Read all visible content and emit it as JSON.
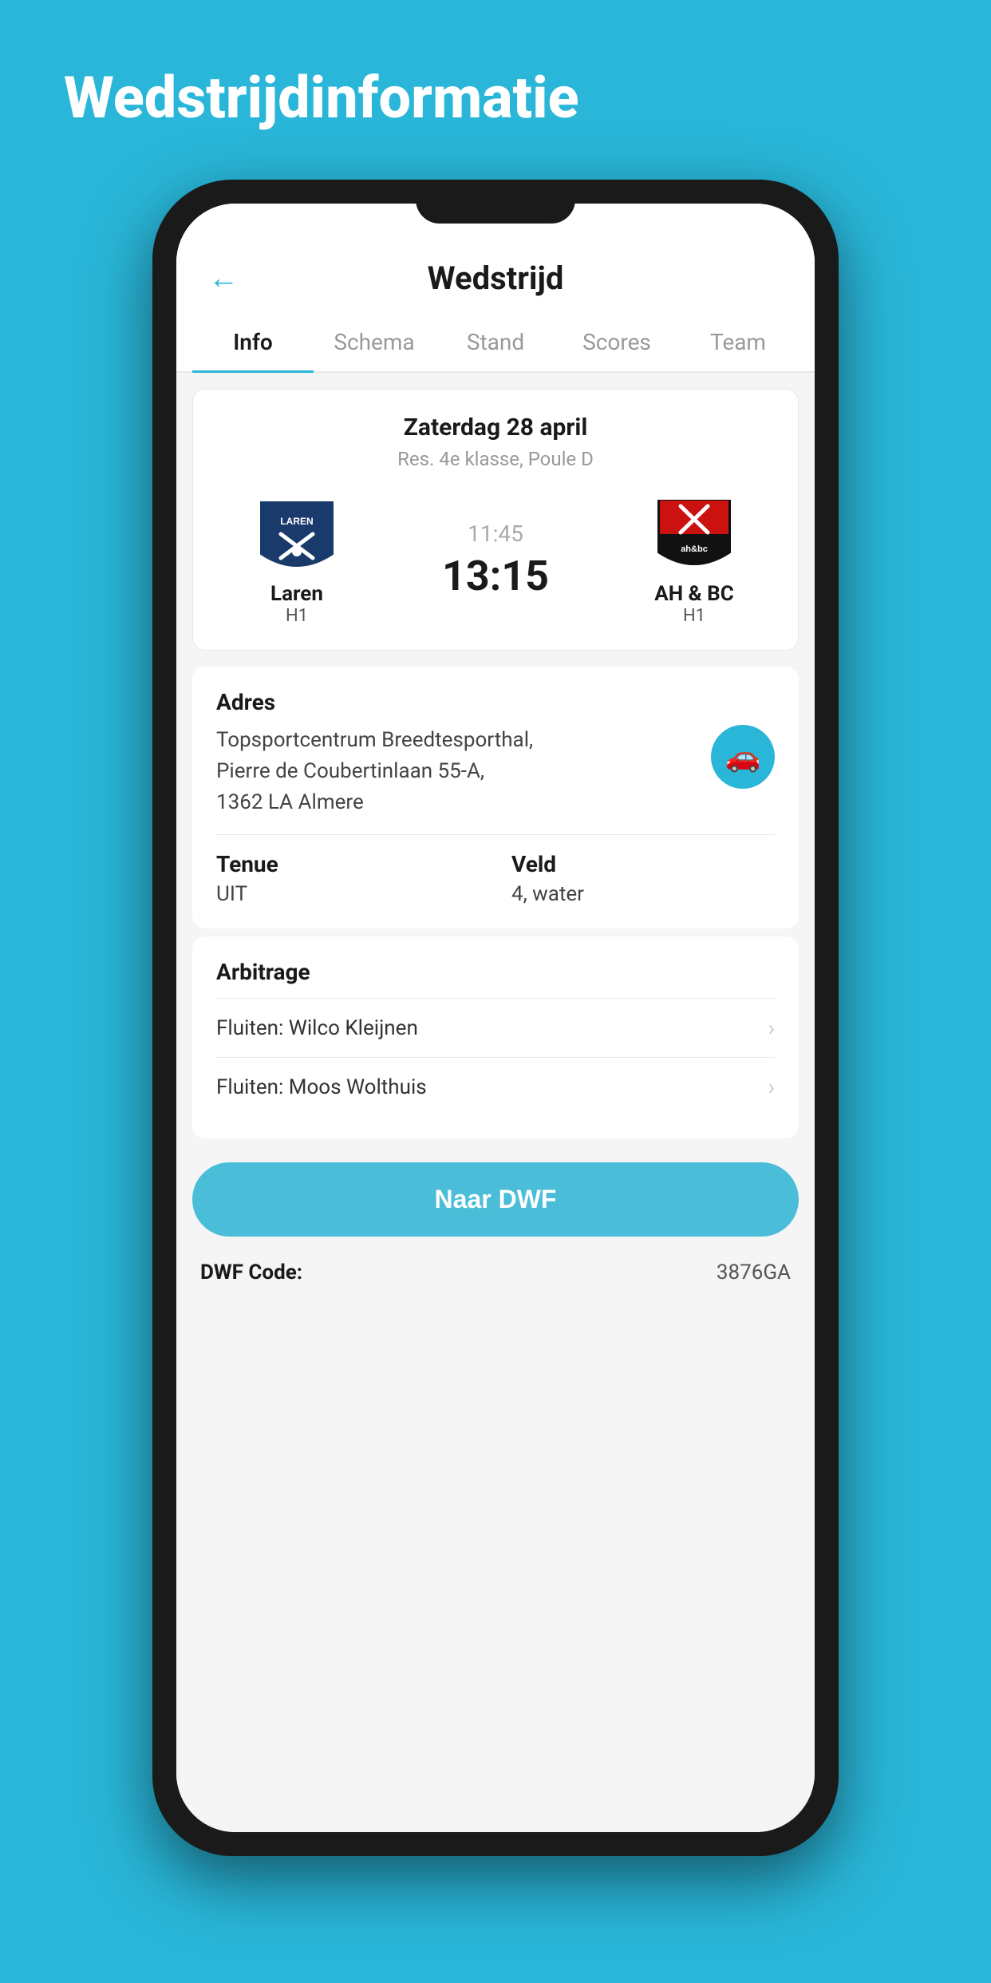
{
  "page": {
    "background_title": "Wedstrijdinformatie",
    "header": {
      "title": "Wedstrijd",
      "back_label": "←"
    },
    "tabs": [
      {
        "label": "Info",
        "active": true
      },
      {
        "label": "Schema",
        "active": false
      },
      {
        "label": "Stand",
        "active": false
      },
      {
        "label": "Scores",
        "active": false
      },
      {
        "label": "Team",
        "active": false
      }
    ],
    "match": {
      "date": "Zaterdag 28 april",
      "league": "Res. 4e klasse, Poule D",
      "home_team_name": "Laren",
      "home_team_sub": "H1",
      "away_team_name": "AH & BC",
      "away_team_sub": "H1",
      "time": "11:45",
      "score": "13:15"
    },
    "address": {
      "label": "Adres",
      "text_line1": "Topsportcentrum Breedtesporthal,",
      "text_line2": "Pierre de Coubertinlaan 55-A,",
      "text_line3": "1362 LA Almere"
    },
    "tenue": {
      "label": "Tenue",
      "value": "UIT"
    },
    "veld": {
      "label": "Veld",
      "value": "4, water"
    },
    "arbitrage": {
      "title": "Arbitrage",
      "items": [
        {
          "name": "Fluiten: Wilco Kleijnen"
        },
        {
          "name": "Fluiten: Moos Wolthuis"
        }
      ]
    },
    "dwf_button_label": "Naar DWF",
    "dwf_code_label": "DWF Code:",
    "dwf_code_value": "3876GA"
  }
}
